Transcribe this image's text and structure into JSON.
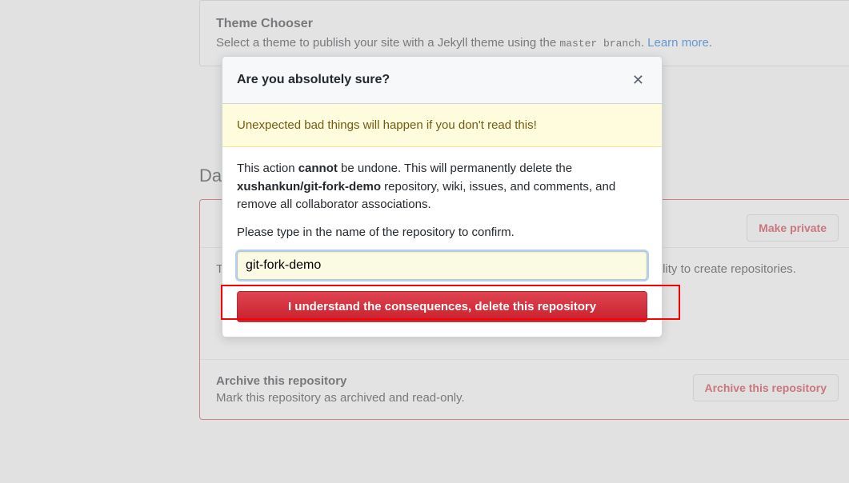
{
  "theme": {
    "title": "Theme Chooser",
    "desc_before": "Select a theme to publish your site with a Jekyll theme using the ",
    "branch_code": "master branch",
    "desc_after": ". ",
    "learn_more": "Learn more",
    "period": "."
  },
  "danger_zone": {
    "heading": "Danger Zone",
    "make_private": {
      "button": "Make private"
    },
    "transfer": {
      "desc": "Transfer this repository to another user or to an organization where you have the ability to create repositories."
    },
    "archive": {
      "title": "Archive this repository",
      "desc": "Mark this repository as archived and read-only.",
      "button": "Archive this repository"
    }
  },
  "modal": {
    "title": "Are you absolutely sure?",
    "flash": "Unexpected bad things will happen if you don't read this!",
    "body1_before": "This action ",
    "body1_bold1": "cannot",
    "body1_mid": " be undone. This will permanently delete the ",
    "body1_bold2": "xushankun/git-fork-demo",
    "body1_after": " repository, wiki, issues, and comments, and remove all collaborator associations.",
    "body2": "Please type in the name of the repository to confirm.",
    "input_value": "git-fork-demo",
    "button": "I understand the consequences, delete this repository"
  }
}
